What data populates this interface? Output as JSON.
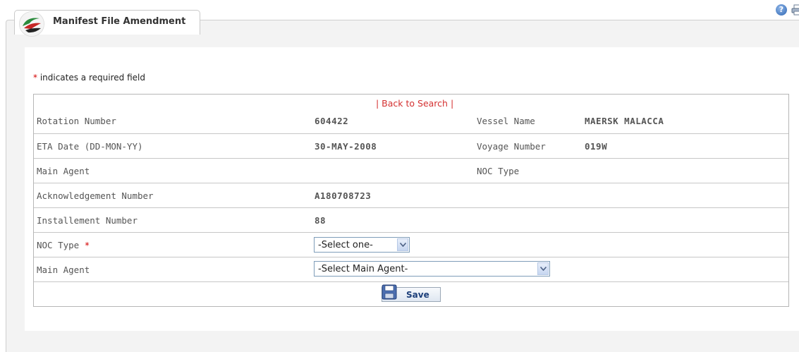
{
  "header": {
    "title": "Manifest File Amendment",
    "help_icon_glyph": "?"
  },
  "form": {
    "required_note": " indicates a required field",
    "required_star": "*",
    "back_link": "| Back to Search |",
    "rows": {
      "rotation_number": {
        "label": "Rotation Number",
        "value": "604422"
      },
      "vessel_name": {
        "label": "Vessel Name",
        "value": "MAERSK MALACCA"
      },
      "eta_date": {
        "label": "ETA Date (DD-MON-YY)",
        "value": "30-MAY-2008"
      },
      "voyage_number": {
        "label": "Voyage Number",
        "value": "019W"
      },
      "main_agent_info": {
        "label": "Main Agent",
        "value": ""
      },
      "noc_type_info": {
        "label": "NOC Type",
        "value": ""
      },
      "ack_number": {
        "label": "Acknowledgement Number",
        "value": "A180708723"
      },
      "installment_number": {
        "label": "Installement Number",
        "value": "88"
      }
    },
    "noc_type_select": {
      "label": "NOC Type",
      "selected": "-Select one-"
    },
    "main_agent_select": {
      "label": "Main Agent",
      "selected": "-Select Main Agent-"
    },
    "save_label": "Save"
  },
  "colors": {
    "required": "#d40000",
    "link": "#d43030",
    "button_text": "#1c3f7a"
  }
}
